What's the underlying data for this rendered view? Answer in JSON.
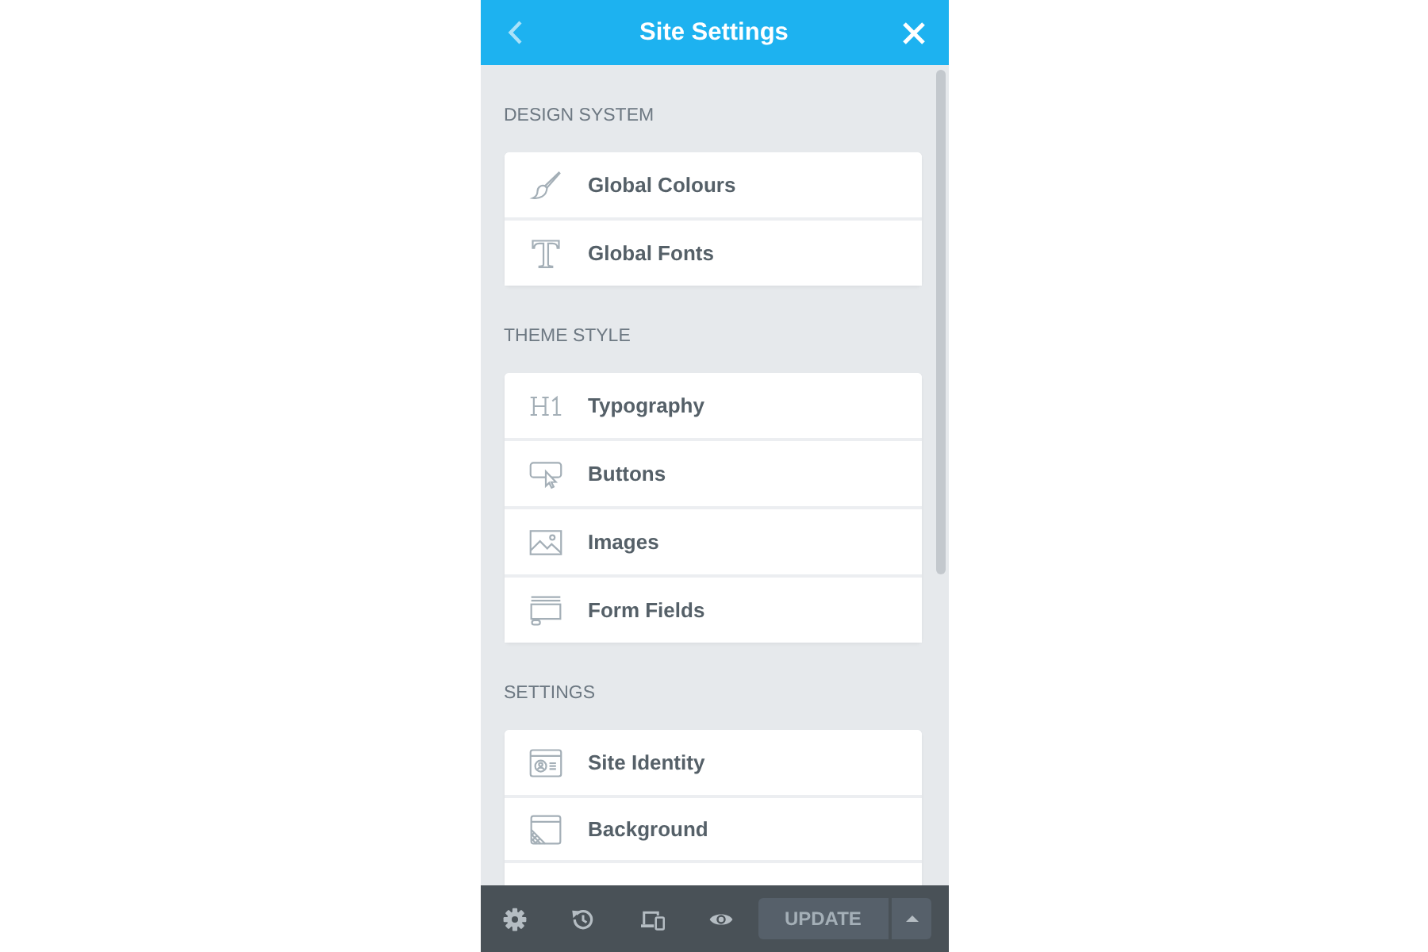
{
  "header": {
    "title": "Site Settings"
  },
  "sections": [
    {
      "heading": "DESIGN SYSTEM",
      "items": [
        {
          "label": "Global Colours",
          "kind": "brush"
        },
        {
          "label": "Global Fonts",
          "kind": "font"
        }
      ]
    },
    {
      "heading": "THEME STYLE",
      "items": [
        {
          "label": "Typography",
          "kind": "heading"
        },
        {
          "label": "Buttons",
          "kind": "button"
        },
        {
          "label": "Images",
          "kind": "image"
        },
        {
          "label": "Form Fields",
          "kind": "form"
        }
      ]
    },
    {
      "heading": "SETTINGS",
      "items": [
        {
          "label": "Site Identity",
          "kind": "identity"
        },
        {
          "label": "Background",
          "kind": "background"
        }
      ]
    }
  ],
  "footer": {
    "update_button": {
      "label": "UPDATE",
      "disabled": true
    }
  }
}
